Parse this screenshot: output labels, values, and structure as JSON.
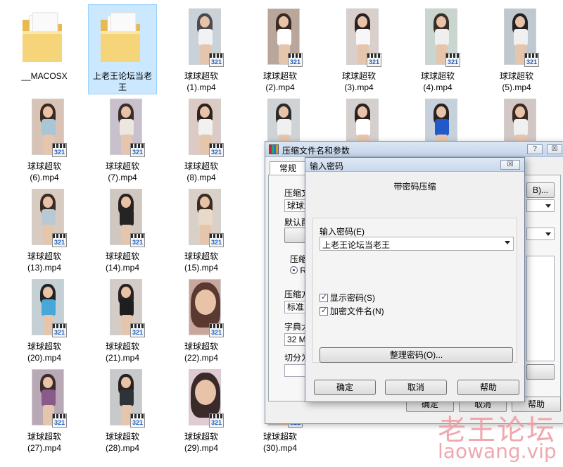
{
  "files": [
    {
      "type": "folder",
      "line1": "__MACOSX",
      "line2": ""
    },
    {
      "type": "folder",
      "line1": "上老王论坛当老",
      "line2": "王",
      "selected": true
    },
    {
      "type": "video",
      "line1": "球球超软",
      "line2": "(1).mp4",
      "colors": [
        "#c9d2d8",
        "#4a4a50",
        "#f2f2f2"
      ]
    },
    {
      "type": "video",
      "line1": "球球超软",
      "line2": "(2).mp4",
      "colors": [
        "#b8a79a",
        "#3b2a22",
        "#ffffff"
      ]
    },
    {
      "type": "video",
      "line1": "球球超软",
      "line2": "(3).mp4",
      "colors": [
        "#d9d0cc",
        "#2a2222",
        "#f7f7f7"
      ]
    },
    {
      "type": "video",
      "line1": "球球超软",
      "line2": "(4).mp4",
      "colors": [
        "#c9d6d0",
        "#3a2e28",
        "#efefef"
      ]
    },
    {
      "type": "video",
      "line1": "球球超软",
      "line2": "(5).mp4",
      "colors": [
        "#bfc8cf",
        "#222222",
        "#f0f0f0"
      ]
    },
    {
      "type": "video",
      "line1": "球球超软",
      "line2": "(6).mp4",
      "colors": [
        "#d8c3b6",
        "#3a2a22",
        "#a8c6d6"
      ]
    },
    {
      "type": "video",
      "line1": "球球超软",
      "line2": "(7).mp4",
      "colors": [
        "#c8c0cc",
        "#3a2e2a",
        "#ece6e0"
      ]
    },
    {
      "type": "video",
      "line1": "球球超软",
      "line2": "(8).mp4",
      "colors": [
        "#dccbc4",
        "#2c2220",
        "#f1f1f1"
      ]
    },
    {
      "type": "video",
      "line1": "球球超软",
      "line2": "(13).mp4",
      "colors": [
        "#d8ccc2",
        "#3a2c24",
        "#b9c9d3"
      ]
    },
    {
      "type": "video",
      "line1": "球球超软",
      "line2": "(14).mp4",
      "colors": [
        "#d0c7c0",
        "#2a2220",
        "#242424"
      ]
    },
    {
      "type": "video",
      "line1": "球球超软",
      "line2": "(15).mp4",
      "colors": [
        "#d9d1c8",
        "#3a2c24",
        "#e9d9c8"
      ]
    },
    {
      "type": "video",
      "line1": "球球超软",
      "line2": "(20).mp4",
      "colors": [
        "#c5d0d6",
        "#222",
        "#49a6d8"
      ]
    },
    {
      "type": "video",
      "line1": "球球超软",
      "line2": "(21).mp4",
      "colors": [
        "#d4ccc6",
        "#2a2222",
        "#1e1e1e"
      ]
    },
    {
      "type": "video",
      "line1": "球球超软",
      "line2": "(22).mp4",
      "colors": [
        "#caa79e",
        "#5a3a30",
        "#f0d6c8"
      ],
      "face": true
    },
    {
      "type": "video",
      "line1": "球球超软",
      "line2": "(27).mp4",
      "colors": [
        "#b9a8b6",
        "#3a2a2a",
        "#8a5a8a"
      ]
    },
    {
      "type": "video",
      "line1": "球球超软",
      "line2": "(28).mp4",
      "colors": [
        "#c7c9cb",
        "#2a2222",
        "#2d3336"
      ]
    },
    {
      "type": "video",
      "line1": "球球超软",
      "line2": "(29).mp4",
      "colors": [
        "#e0cbd2",
        "#3a2a2a",
        "#f3e4e4"
      ],
      "face": true
    },
    {
      "type": "video",
      "line1": "球球超软",
      "line2": "(30).mp4",
      "colors": [
        "#c8c8c8",
        "#2a2a2a",
        "#eeeeee"
      ]
    },
    {
      "type": "video",
      "line1": "",
      "line2": "",
      "colors": [
        "#cfd3d6",
        "#2a2a2a",
        "#f0f0f0"
      ]
    },
    {
      "type": "video",
      "line1": "",
      "line2": "",
      "colors": [
        "#d5cfcd",
        "#2a2222",
        "#ffffff"
      ]
    },
    {
      "type": "video",
      "line1": "",
      "line2": "",
      "colors": [
        "#c7d1dc",
        "#2a2222",
        "#2259c8"
      ]
    },
    {
      "type": "video",
      "line1": "",
      "line2": "",
      "colors": [
        "#d3c7c5",
        "#3a2a22",
        "#f0f0f0"
      ]
    }
  ],
  "badge_number": "321",
  "back_dialog": {
    "title": "压缩文件名和参数",
    "help_btn": "?",
    "close_btn": "☒",
    "tab_general": "常规",
    "archive_name_label": "压缩文",
    "archive_name_value": "球球超",
    "browse_btn": "B)...",
    "default_profile_label": "默认配",
    "format_label": "压缩",
    "format_radio": "Ra",
    "method_label": "压缩方",
    "method_value": "标准",
    "dict_label": "字典大",
    "dict_value": "32 MB",
    "split_label": "切分为",
    "ok_btn": "确定",
    "cancel_btn": "取消",
    "help_label": "帮助"
  },
  "front_dialog": {
    "title": "输入密码",
    "close_btn": "☒",
    "heading": "带密码压缩",
    "password_label": "输入密码(E)",
    "password_value": "上老王论坛当老王",
    "show_password": "显示密码(S)",
    "encrypt_names": "加密文件名(N)",
    "organize_btn": "整理密码(O)...",
    "ok_btn": "确定",
    "cancel_btn": "取消",
    "help_btn": "帮助"
  },
  "watermark": {
    "cn": "老王论坛",
    "url": "laowang.vip"
  }
}
